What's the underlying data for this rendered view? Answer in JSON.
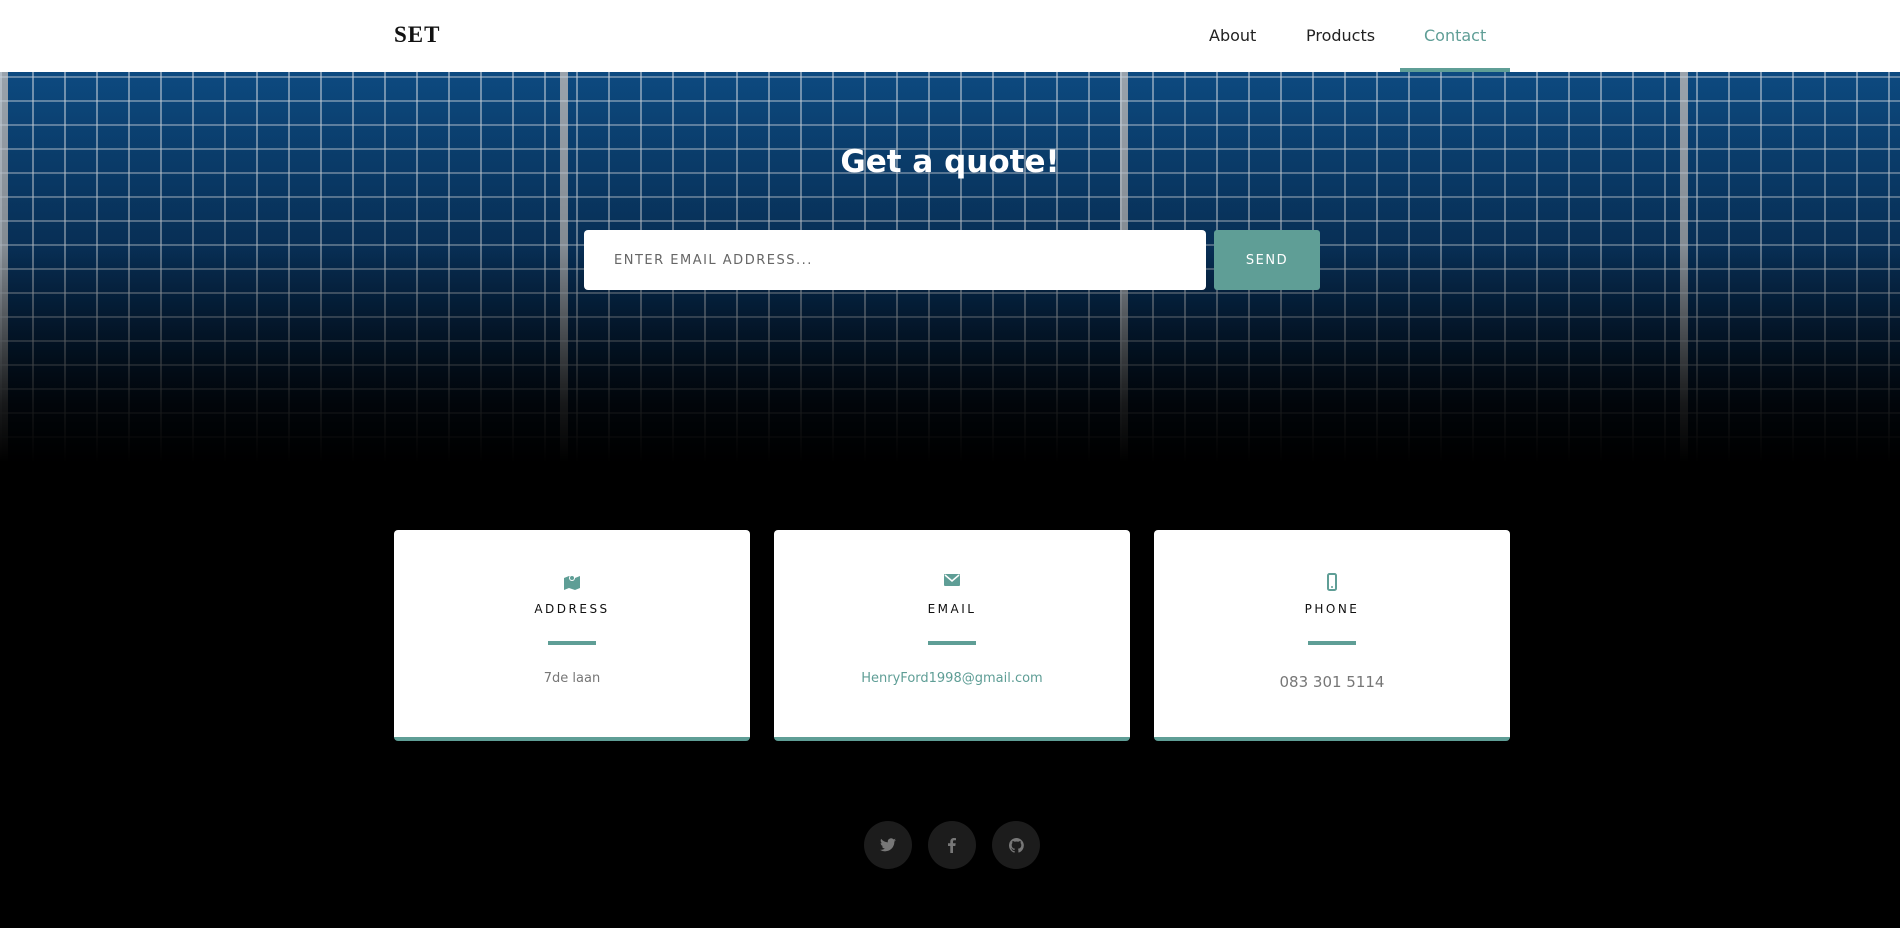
{
  "nav": {
    "logo": "SET",
    "items": [
      {
        "label": "About"
      },
      {
        "label": "Products"
      },
      {
        "label": "Contact",
        "active": true
      }
    ]
  },
  "hero": {
    "title": "Get a quote!",
    "email_placeholder": "ENTER EMAIL ADDRESS...",
    "send_label": "SEND"
  },
  "cards": [
    {
      "icon": "map-marker-icon",
      "title": "ADDRESS",
      "value": "7de laan"
    },
    {
      "icon": "envelope-icon",
      "title": "EMAIL",
      "value": "HenryFord1998@gmail.com"
    },
    {
      "icon": "mobile-phone-icon",
      "title": "PHONE",
      "value": "083 301 5114"
    }
  ],
  "social": [
    "twitter-icon",
    "facebook-icon",
    "github-icon"
  ],
  "colors": {
    "accent": "#5f9e96",
    "background": "#000000"
  }
}
